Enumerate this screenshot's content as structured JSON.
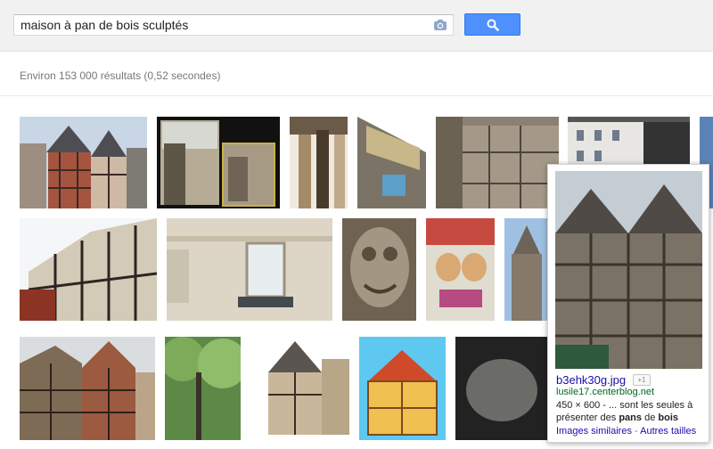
{
  "search": {
    "query": "maison à pan de bois sculptés"
  },
  "icons": {
    "camera": "camera-icon",
    "search": "magnifier-icon"
  },
  "stats": {
    "text": "Environ 153 000 résultats (0,52 secondes)"
  },
  "preview": {
    "title": "b3ehk30g.jpg",
    "plus_one": "+1",
    "domain": "lusile17.centerblog.net",
    "dimensions": "450 × 600",
    "snippet_mid": " - ... sont les seules à présenter des ",
    "snippet_bold_1": "pans",
    "snippet_de": " de ",
    "snippet_bold_2": "bois",
    "similar_link": "Images similaires",
    "separator": " - ",
    "sizes_link": "Autres tailles"
  },
  "colors": {
    "search_button": "#4d90fe",
    "link": "#1a0dab",
    "domain": "#006621"
  }
}
